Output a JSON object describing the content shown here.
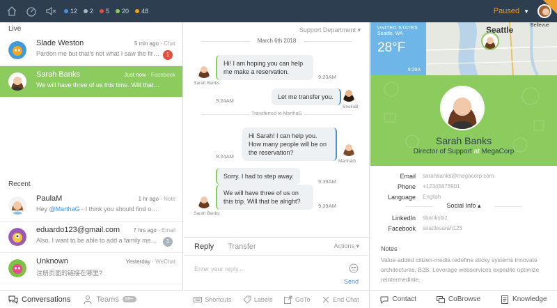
{
  "topbar": {
    "counts": [
      {
        "value": "12",
        "color": "#4a90d9",
        "name": "status-count-blue"
      },
      {
        "value": "2",
        "color": "#aab4bc",
        "name": "status-count-gray"
      },
      {
        "value": "5",
        "color": "#e74c3c",
        "name": "status-count-red"
      },
      {
        "value": "20",
        "color": "#8ccb5e",
        "name": "status-count-green"
      },
      {
        "value": "48",
        "color": "#f39c12",
        "name": "status-count-orange"
      }
    ],
    "status": "Paused",
    "icons": [
      "home-icon",
      "dashboard-icon",
      "mute-icon"
    ]
  },
  "left": {
    "live_title": "Live",
    "recent_title": "Recent",
    "live": [
      {
        "name": "Slade Weston",
        "time": "5 min ago",
        "channel": "Chat",
        "message": "Pardon me but that's not what I saw the first time I had this problem.",
        "badge": "1",
        "badge_color": "#e74c3c"
      },
      {
        "name": "Sarah Banks",
        "time": "Just now",
        "channel": "Facebook",
        "message": "We will have three of us this time. Will that be alright?",
        "active": true
      }
    ],
    "recent": [
      {
        "name": "PaulaM",
        "time": "1 hr ago",
        "channel": "Note",
        "mention": "@MarthaG",
        "message_pre": "Hey ",
        "message": " - I think you should find out what is going on here."
      },
      {
        "name": "eduardo123@gmail.com",
        "time": "7 hrs ago",
        "channel": "Email",
        "message": "Also, I want to be able to add a family member to my account.",
        "badge": "1",
        "badge_color": "#aab4bc"
      },
      {
        "name": "Unknown",
        "time": "Yesterday",
        "channel": "WeChat",
        "message": "注册页面的链接在哪里?"
      }
    ],
    "bottom": {
      "conversations": "Conversations",
      "teams": "Teams",
      "teams_badge": "99+"
    }
  },
  "chat": {
    "department": "Support Department",
    "date": "March 6th 2018",
    "messages": [
      {
        "text": "Hi! I am hoping you can help me make a reservation.",
        "time": "9:23AM",
        "sender": "Sarah Banks"
      },
      {
        "text": "Let me transfer you.",
        "time": "9:24AM",
        "sender": "SheilaB"
      },
      {
        "text": "Hi Sarah! I can help you. How many people will be on the reservation?",
        "time": "9:24AM",
        "sender": "MarthaG"
      },
      {
        "text": "Sorry. I had to step away.",
        "time": "9:39AM"
      },
      {
        "text": "We will have three of us on this trip. Will that be alright?",
        "time": "9:39AM",
        "sender": "Sarah Banks"
      }
    ],
    "transfer_note": "Transferred to MarthaG",
    "reply_tab": "Reply",
    "transfer_tab": "Transfer",
    "actions": "Actions",
    "placeholder": "Enter your reply...",
    "send": "Send",
    "toolbar": {
      "shortcuts": "Shortcuts",
      "labels": "Labels",
      "goto": "GoTo",
      "end": "End Chat"
    }
  },
  "profile": {
    "weather": {
      "location": "UNITED STATES",
      "city": "Seattle, WA",
      "temp": "28°F",
      "time": "9:29A"
    },
    "map_labels": {
      "city": "Seattle",
      "bellevue": "Bellevue"
    },
    "name": "Sarah Banks",
    "title": "Director of Support",
    "at": "at",
    "company": "MegaCorp",
    "email_label": "Email",
    "email": "sarahbanks@megacorp.com",
    "phone_label": "Phone",
    "phone": "+12345678901",
    "language_label": "Language",
    "language": "English",
    "social_title": "Social Info",
    "linkedin_label": "LinkedIn",
    "linkedin": "sbanksbiz",
    "facebook_label": "Facebook",
    "facebook": "seattlesarah123",
    "notes_title": "Notes",
    "notes": "Value-added citizen-media redefine sticky systems innovate architectures, B2B. Leverage webservices expedite optimize reintermediate.",
    "actions": {
      "contact": "Contact",
      "cobrowse": "CoBrowse",
      "knowledge": "Knowledge"
    }
  }
}
